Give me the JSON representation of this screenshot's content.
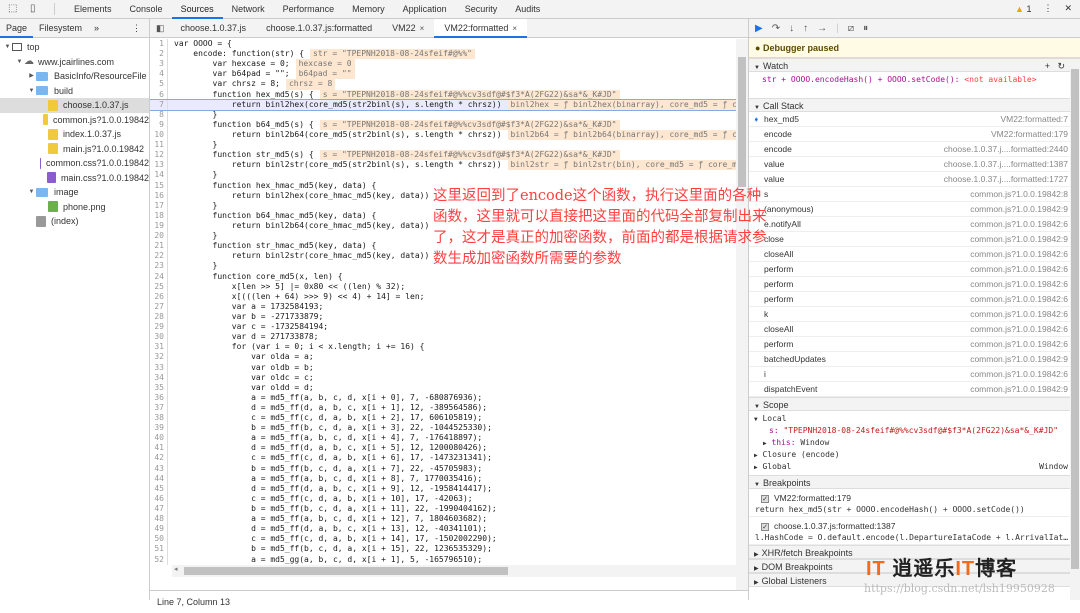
{
  "toolbar": {
    "tabs": [
      "Elements",
      "Console",
      "Sources",
      "Network",
      "Performance",
      "Memory",
      "Application",
      "Security",
      "Audits"
    ],
    "active": "Sources",
    "warning_count": "1"
  },
  "navigator": {
    "tabs": [
      "Page",
      "Filesystem"
    ],
    "more": "»",
    "tree": [
      {
        "label": "top",
        "depth": 0,
        "kind": "frame",
        "arrow": "▼"
      },
      {
        "label": "www.jcairlines.com",
        "depth": 1,
        "kind": "cloud",
        "arrow": "▼"
      },
      {
        "label": "BasicInfo/ResourceFile",
        "depth": 2,
        "kind": "folder",
        "arrow": "▶"
      },
      {
        "label": "build",
        "depth": 2,
        "kind": "folder",
        "arrow": "▼"
      },
      {
        "label": "choose.1.0.37.js",
        "depth": 3,
        "kind": "js",
        "selected": true
      },
      {
        "label": "common.js?1.0.0.19842",
        "depth": 3,
        "kind": "js"
      },
      {
        "label": "index.1.0.37.js",
        "depth": 3,
        "kind": "js"
      },
      {
        "label": "main.js?1.0.0.19842",
        "depth": 3,
        "kind": "js"
      },
      {
        "label": "common.css?1.0.0.19842",
        "depth": 3,
        "kind": "css"
      },
      {
        "label": "main.css?1.0.0.19842",
        "depth": 3,
        "kind": "css"
      },
      {
        "label": "image",
        "depth": 2,
        "kind": "folder",
        "arrow": "▼"
      },
      {
        "label": "phone.png",
        "depth": 3,
        "kind": "img"
      },
      {
        "label": "(index)",
        "depth": 2,
        "kind": "doc"
      }
    ]
  },
  "editor": {
    "tabs": [
      {
        "label": "choose.1.0.37.js"
      },
      {
        "label": "choose.1.0.37.js:formatted"
      },
      {
        "label": "VM22",
        "close": "×"
      },
      {
        "label": "VM22:formatted",
        "close": "×",
        "active": true
      }
    ],
    "current_line": 7,
    "lines": [
      {
        "t": "var OOOO = {"
      },
      {
        "t": "    encode: function(str) {",
        "i": "str = \"TPEPNH2018-08-24sfeif#@%%\""
      },
      {
        "t": "        var hexcase = 0;",
        "i": "hexcase = 0"
      },
      {
        "t": "        var b64pad = \"\";",
        "i": "b64pad = \"\""
      },
      {
        "t": "        var chrsz = 8;",
        "i": "chrsz = 8"
      },
      {
        "t": "        function hex_md5(s) {",
        "i": "s = \"TPEPNH2018-08-24sfeif#@%%cv3sdf@#$f3*A(2FG22)&sa*&_K#JD\""
      },
      {
        "t": "            return binl2hex(core_md5(str2binl(s), s.length * chrsz))",
        "i": "binl2hex = ƒ binl2hex(binarray), core_md5 = ƒ core_md5(x, len)"
      },
      {
        "t": "        }"
      },
      {
        "t": "        function b64_md5(s) {",
        "i": "s = \"TPEPNH2018-08-24sfeif#@%%cv3sdf@#$f3*A(2FG22)&sa*&_K#JD\""
      },
      {
        "t": "            return binl2b64(core_md5(str2binl(s), s.length * chrsz))",
        "i": "binl2b64 = ƒ binl2b64(binarray), core_md5 = ƒ core_md5(x, len)"
      },
      {
        "t": "        }"
      },
      {
        "t": "        function str_md5(s) {",
        "i": "s = \"TPEPNH2018-08-24sfeif#@%%cv3sdf@#$f3*A(2FG22)&sa*&_K#JD\""
      },
      {
        "t": "            return binl2str(core_md5(str2binl(s), s.length * chrsz))",
        "i": "binl2str = ƒ binl2str(bin), core_md5 = ƒ core_md5(x, len)"
      },
      {
        "t": "        }"
      },
      {
        "t": "        function hex_hmac_md5(key, data) {"
      },
      {
        "t": "            return binl2hex(core_hmac_md5(key, data))"
      },
      {
        "t": "        }"
      },
      {
        "t": "        function b64_hmac_md5(key, data) {"
      },
      {
        "t": "            return binl2b64(core_hmac_md5(key, data))"
      },
      {
        "t": "        }"
      },
      {
        "t": "        function str_hmac_md5(key, data) {"
      },
      {
        "t": "            return binl2str(core_hmac_md5(key, data))"
      },
      {
        "t": "        }"
      },
      {
        "t": "        function core_md5(x, len) {"
      },
      {
        "t": "            x[len >> 5] |= 0x80 << ((len) % 32);"
      },
      {
        "t": "            x[(((len + 64) >>> 9) << 4) + 14] = len;"
      },
      {
        "t": "            var a = 1732584193;"
      },
      {
        "t": "            var b = -271733879;"
      },
      {
        "t": "            var c = -1732584194;"
      },
      {
        "t": "            var d = 271733878;"
      },
      {
        "t": "            for (var i = 0; i < x.length; i += 16) {"
      },
      {
        "t": "                var olda = a;"
      },
      {
        "t": "                var oldb = b;"
      },
      {
        "t": "                var oldc = c;"
      },
      {
        "t": "                var oldd = d;"
      },
      {
        "t": "                a = md5_ff(a, b, c, d, x[i + 0], 7, -680876936);"
      },
      {
        "t": "                d = md5_ff(d, a, b, c, x[i + 1], 12, -389564586);"
      },
      {
        "t": "                c = md5_ff(c, d, a, b, x[i + 2], 17, 606105819);"
      },
      {
        "t": "                b = md5_ff(b, c, d, a, x[i + 3], 22, -1044525330);"
      },
      {
        "t": "                a = md5_ff(a, b, c, d, x[i + 4], 7, -176418897);"
      },
      {
        "t": "                d = md5_ff(d, a, b, c, x[i + 5], 12, 1200080426);"
      },
      {
        "t": "                c = md5_ff(c, d, a, b, x[i + 6], 17, -1473231341);"
      },
      {
        "t": "                b = md5_ff(b, c, d, a, x[i + 7], 22, -45705983);"
      },
      {
        "t": "                a = md5_ff(a, b, c, d, x[i + 8], 7, 1770035416);"
      },
      {
        "t": "                d = md5_ff(d, a, b, c, x[i + 9], 12, -1958414417);"
      },
      {
        "t": "                c = md5_ff(c, d, a, b, x[i + 10], 17, -42063);"
      },
      {
        "t": "                b = md5_ff(b, c, d, a, x[i + 11], 22, -1990404162);"
      },
      {
        "t": "                a = md5_ff(a, b, c, d, x[i + 12], 7, 1804603682);"
      },
      {
        "t": "                d = md5_ff(d, a, b, c, x[i + 13], 12, -40341101);"
      },
      {
        "t": "                c = md5_ff(c, d, a, b, x[i + 14], 17, -1502002290);"
      },
      {
        "t": "                b = md5_ff(b, c, d, a, x[i + 15], 22, 1236535329);"
      },
      {
        "t": "                a = md5_gg(a, b, c, d, x[i + 1], 5, -165796510);"
      },
      {
        "t": ""
      }
    ],
    "status": "Line 7, Column 13"
  },
  "annotation": {
    "color": "#ff4040",
    "lines": [
      "这里返回到了encode这个函数，执行这里面的各种",
      "函数，这里就可以直接把这里面的代码全部复制出来",
      "了，这才是真正的加密函数，前面的都是根据请求参",
      "数生成加密函数所需要的参数"
    ]
  },
  "debugger": {
    "paused_message": "Debugger paused",
    "watch": {
      "title": "Watch",
      "expression": "str + OOOO.encodeHash() + OOOO.setCode():",
      "value": "<not available>"
    },
    "call_stack": {
      "title": "Call Stack",
      "frames": [
        {
          "fn": "hex_md5",
          "loc": "VM22:formatted:7",
          "current": true
        },
        {
          "fn": "encode",
          "loc": "VM22:formatted:179"
        },
        {
          "fn": "encode",
          "loc": "choose.1.0.37.j....formatted:2440"
        },
        {
          "fn": "value",
          "loc": "choose.1.0.37.j....formatted:1387"
        },
        {
          "fn": "value",
          "loc": "choose.1.0.37.j....formatted:1727"
        },
        {
          "fn": "s",
          "loc": "common.js?1.0.0.19842:8"
        },
        {
          "fn": "(anonymous)",
          "loc": "common.js?1.0.0.19842:9"
        },
        {
          "fn": "e.notifyAll",
          "loc": "common.js?1.0.0.19842:6"
        },
        {
          "fn": "close",
          "loc": "common.js?1.0.0.19842:9"
        },
        {
          "fn": "closeAll",
          "loc": "common.js?1.0.0.19842:6"
        },
        {
          "fn": "perform",
          "loc": "common.js?1.0.0.19842:6"
        },
        {
          "fn": "perform",
          "loc": "common.js?1.0.0.19842:6"
        },
        {
          "fn": "perform",
          "loc": "common.js?1.0.0.19842:6"
        },
        {
          "fn": "k",
          "loc": "common.js?1.0.0.19842:6"
        },
        {
          "fn": "closeAll",
          "loc": "common.js?1.0.0.19842:6"
        },
        {
          "fn": "perform",
          "loc": "common.js?1.0.0.19842:6"
        },
        {
          "fn": "batchedUpdates",
          "loc": "common.js?1.0.0.19842:9"
        },
        {
          "fn": "i",
          "loc": "common.js?1.0.0.19842:6"
        },
        {
          "fn": "dispatchEvent",
          "loc": "common.js?1.0.0.19842:9"
        }
      ]
    },
    "scope": {
      "title": "Scope",
      "local": "Local",
      "s_key": "s:",
      "s_val": "\"TPEPNH2018-08-24sfeif#@%%cv3sdf@#$f3*A(2FG22)&sa*&_K#JD\"",
      "this_key": "this:",
      "this_val": "Window",
      "closure": "Closure (encode)",
      "global": "Global",
      "global_val": "Window"
    },
    "breakpoints": {
      "title": "Breakpoints",
      "items": [
        {
          "loc": "VM22:formatted:179",
          "code": "return hex_md5(str + OOOO.encodeHash() + OOOO.setCode())",
          "checked": true
        },
        {
          "loc": "choose.1.0.37.js:formatted:1387",
          "code": "l.HashCode = O.default.encode(l.DepartureIataCode + l.ArrivalIat…",
          "checked": true
        }
      ]
    },
    "xhr": "XHR/fetch Breakpoints",
    "dom": "DOM Breakpoints",
    "listeners": "Global Listeners"
  },
  "watermark": {
    "logo": "IT",
    "name_pre": "逍遥乐",
    "name_it": "IT",
    "name_post": "博客",
    "url": "https://blog.csdn.net/lsh19950928"
  }
}
